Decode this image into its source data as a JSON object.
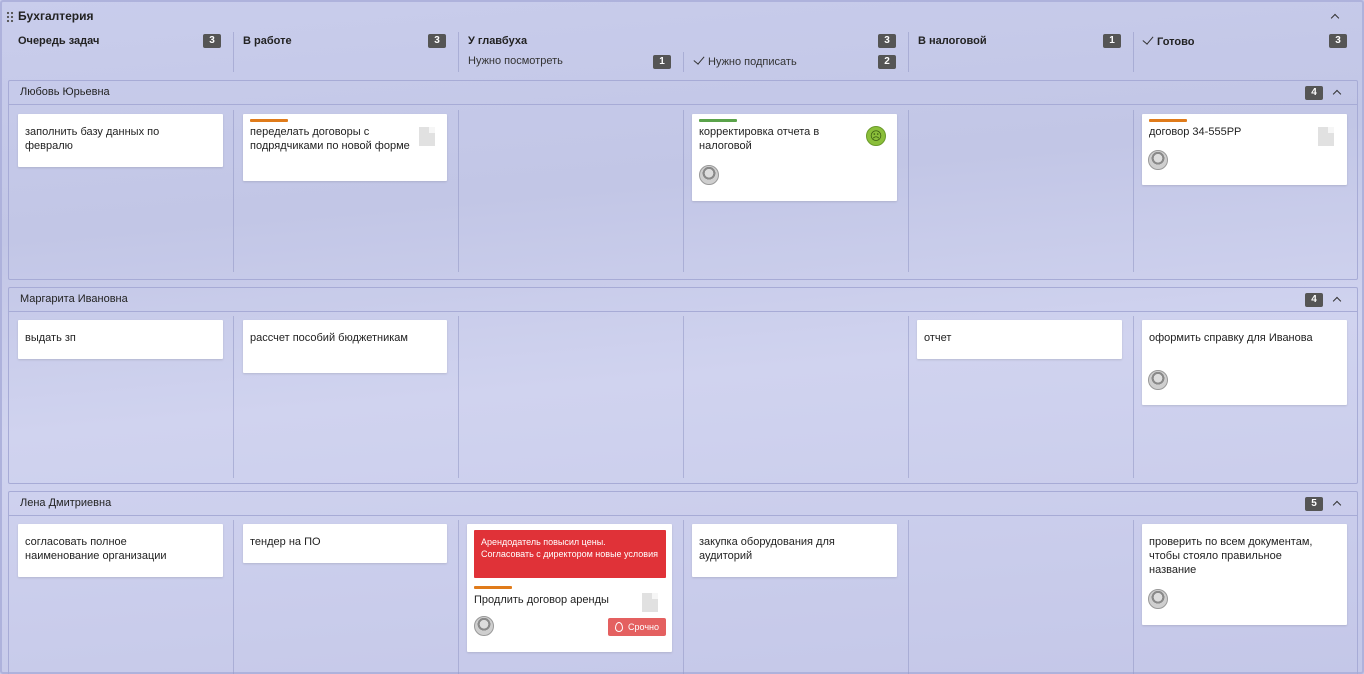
{
  "board": {
    "title": "Бухгалтерия"
  },
  "columns": [
    {
      "name": "Очередь задач",
      "count": "3"
    },
    {
      "name": "В работе",
      "count": "3"
    },
    {
      "name": "У главбуха",
      "count": "3",
      "subs": [
        {
          "name": "Нужно посмотреть",
          "count": "1"
        },
        {
          "name": "Нужно подписать",
          "count": "2"
        }
      ]
    },
    {
      "name": "В налоговой",
      "count": "1"
    },
    {
      "name": "Готово",
      "count": "3"
    }
  ],
  "lanes": [
    {
      "name": "Любовь Юрьевна",
      "count": "4",
      "cards": [
        {
          "text": "заполнить базу данных по февралю"
        },
        {
          "text": "переделать договоры с подрядчиками по новой форме"
        },
        {
          "text": "корректировка отчета в налоговой"
        },
        {
          "text": "договор 34-555РР"
        }
      ]
    },
    {
      "name": "Маргарита Ивановна",
      "count": "4",
      "cards": [
        {
          "text": "выдать зп"
        },
        {
          "text": "рассчет пособий бюджетникам"
        },
        {
          "text": "отчет"
        },
        {
          "text": "оформить справку для Иванова"
        }
      ]
    },
    {
      "name": "Лена Дмитриевна",
      "count": "5",
      "cards": [
        {
          "text": "согласовать полное наименование организации"
        },
        {
          "text": "тендер на ПО"
        },
        {
          "text": "Продлить договор аренды",
          "alert": "Арендодатель повысил цены. Согласовать с директором новые условия",
          "urgent": "Срочно"
        },
        {
          "text": "закупка оборудования для аудиторий"
        },
        {
          "text": "проверить по всем документам, чтобы стояло правильное название"
        }
      ]
    }
  ],
  "colors": {
    "orange_stripe": "#e07b1a",
    "green_stripe": "#5aa34a",
    "alert_red": "#e03238",
    "badge": "#555555"
  }
}
